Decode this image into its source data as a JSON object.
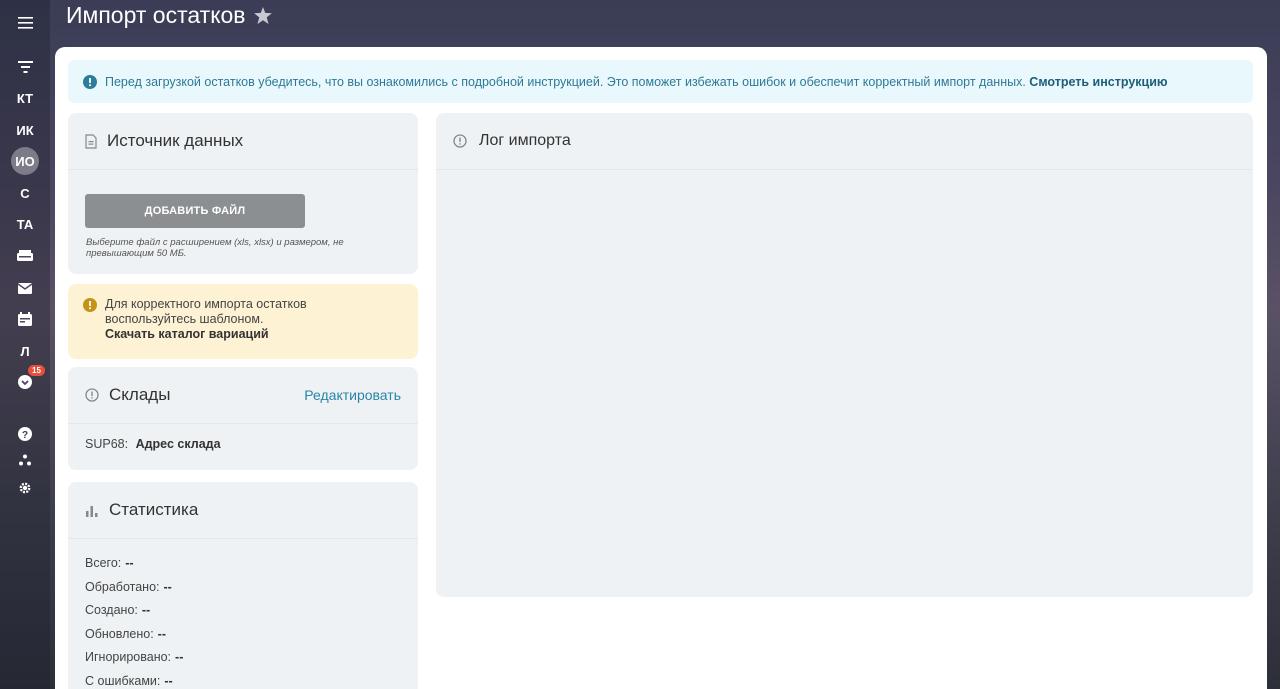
{
  "rail": {
    "items": [
      {
        "label": "КТ"
      },
      {
        "label": "ИК"
      },
      {
        "label": "ИО"
      },
      {
        "label": "С"
      },
      {
        "label": "ТА"
      },
      {
        "label": "Л"
      }
    ],
    "badge": "15"
  },
  "header": {
    "title": "Импорт остатков"
  },
  "notice": {
    "text": "Перед загрузкой остатков убедитесь, что вы ознакомились с подробной инструкцией. Это поможет избежать ошибок и обеспечит корректный импорт данных.",
    "link": "Смотреть инструкцию"
  },
  "source": {
    "title": "Источник данных",
    "add_button": "ДОБАВИТЬ ФАЙЛ",
    "hint": "Выберите файл с расширением (xls, xlsx) и размером, не превышающим 50 МБ."
  },
  "template_warning": {
    "text": "Для корректного импорта остатков воспользуйтесь шаблоном.",
    "link": "Скачать каталог вариаций"
  },
  "warehouses": {
    "title": "Склады",
    "edit_label": "Редактировать",
    "code": "SUP68:",
    "address": "Адрес склада"
  },
  "statistics": {
    "title": "Статистика",
    "rows": [
      {
        "label": "Всего:",
        "value": "--"
      },
      {
        "label": "Обработано:",
        "value": "--"
      },
      {
        "label": "Создано:",
        "value": "--"
      },
      {
        "label": "Обновлено:",
        "value": "--"
      },
      {
        "label": "Игнорировано:",
        "value": "--"
      },
      {
        "label": "С ошибками:",
        "value": "--"
      }
    ]
  },
  "log": {
    "title": "Лог импорта"
  },
  "colors": {
    "accent": "#2a85a8",
    "notice_bg": "#e9f8fd",
    "warning_bg": "#fef2d4",
    "panel_bg": "#eef2f4",
    "button_bg": "#8c8f91",
    "badge": "#e8503a"
  }
}
